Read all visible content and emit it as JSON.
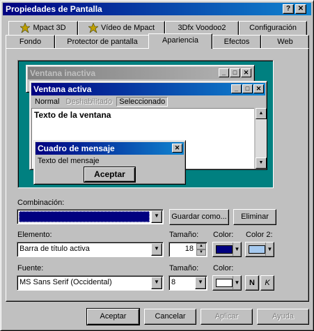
{
  "window": {
    "title": "Propiedades de Pantalla",
    "help_button": "?",
    "close_button": "✕"
  },
  "tabs": {
    "row_back": [
      {
        "label": "Mpact 3D",
        "icon": "mpact-icon"
      },
      {
        "label": "Vídeo de Mpact",
        "icon": "mpact-icon"
      },
      {
        "label": "3Dfx Voodoo2",
        "icon": ""
      },
      {
        "label": "Configuración",
        "icon": ""
      }
    ],
    "row_front": [
      {
        "label": "Fondo"
      },
      {
        "label": "Protector de pantalla"
      },
      {
        "label": "Apariencia"
      },
      {
        "label": "Efectos"
      },
      {
        "label": "Web"
      }
    ],
    "selected": "Apariencia"
  },
  "preview": {
    "inactive_title": "Ventana inactiva",
    "active_title": "Ventana activa",
    "menu": {
      "normal": "Normal",
      "disabled": "Deshabilitado",
      "selected": "Seleccionado"
    },
    "window_text": "Texto de la ventana",
    "msgbox_title": "Cuadro de mensaje",
    "msgbox_text": "Texto del mensaje",
    "msgbox_button": "Aceptar",
    "desktop_color": "#008080"
  },
  "form": {
    "combinacion_label": "Combinación:",
    "combinacion_value": "",
    "guardar_button": "Guardar como...",
    "eliminar_button": "Eliminar",
    "elemento_label": "Elemento:",
    "elemento_value": "Barra de título activa",
    "tamano_label": "Tamaño:",
    "tamano_value": "18",
    "color_label": "Color:",
    "color_value": "#000080",
    "color2_label": "Color 2:",
    "color2_value": "#a6caf0",
    "fuente_label": "Fuente:",
    "fuente_value": "MS Sans Serif (Occidental)",
    "font_tamano_label": "Tamaño:",
    "font_tamano_value": "8",
    "font_color_label": "Color:",
    "font_color_value": "#ffffff",
    "bold_button": "N",
    "italic_button": "K"
  },
  "footer": {
    "aceptar": "Aceptar",
    "cancelar": "Cancelar",
    "aplicar": "Aplicar",
    "ayuda": "Ayuda"
  }
}
